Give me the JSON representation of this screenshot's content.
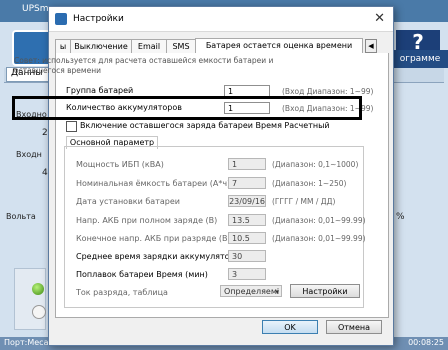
{
  "background": {
    "app_title": "UPSm",
    "tab_label": "Данны",
    "right_label": "ограмме",
    "help_glyph": "?",
    "left_labels": [
      "Входно",
      "Входн",
      "Вольта"
    ],
    "left_values": [
      "2",
      "4"
    ],
    "right_percent": "%",
    "status_left": "Порт:Меса 33 · состоянии ...",
    "status_right": "00:08:25"
  },
  "dialog": {
    "title": "Настройки",
    "close_glyph": "✕",
    "tabs": [
      {
        "label": "ы"
      },
      {
        "label": "Выключение"
      },
      {
        "label": "Email"
      },
      {
        "label": "SMS"
      },
      {
        "label": "Батарея остается оценка времени"
      }
    ],
    "tab_arrow_left": "◀",
    "tab_arrow_right": "▶",
    "hint": "Совет: используется для расчета оставшейся емкости батареи и оставшегося времени",
    "battery_group": {
      "label": "Группа батарей",
      "value": "1",
      "range": "(Вход Диапазон: 1~99)"
    },
    "battery_count": {
      "label": "Количество аккумуляторов",
      "value": "1",
      "range": "(Вход Диапазон: 1~99)"
    },
    "checkbox_label": "Включение оставшегося заряда батареи Время Расчетный",
    "section_label": "Основной параметр",
    "params": [
      {
        "label": "Мощность ИБП (кВА)",
        "value": "1",
        "range": "(Диапазон: 0,1~1000)"
      },
      {
        "label": "Номинальная ёмкость батареи (А*ч)",
        "value": "7",
        "range": "(Диапазон: 1~250)"
      },
      {
        "label": "Дата установки батареи",
        "value": "2023/09/16",
        "range": "(ГГГГ / ММ / ДД)"
      },
      {
        "label": "Напр. АКБ при полном заряде (В)",
        "value": "13.5",
        "range": "(Диапазон: 0,01~99.99)"
      },
      {
        "label": "Конечное напр. АКБ при разряде (В)",
        "value": "10.5",
        "range": "(Диапазон: 0,01~99.99)"
      }
    ],
    "avg_charge": {
      "label": "Среднее время зарядки аккумулятора(ми",
      "value": "30"
    },
    "float_time": {
      "label": "Поплавок батареи Время (мин)",
      "value": "3"
    },
    "discharge": {
      "label": "Ток разряда, таблица",
      "combo": "Определяемі",
      "button": "Настройки"
    },
    "ok_label": "OK",
    "cancel_label": "Отмена"
  }
}
